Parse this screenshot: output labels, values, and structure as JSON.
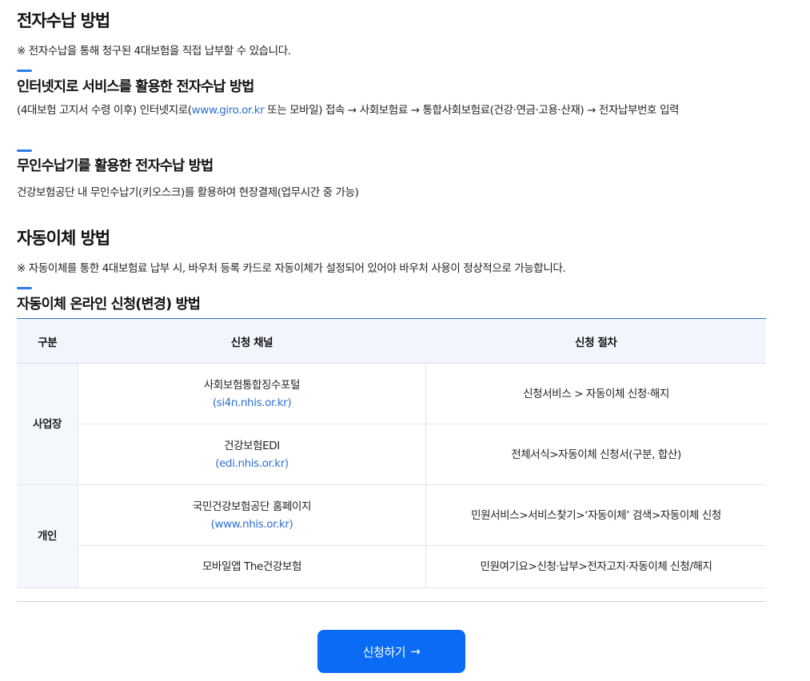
{
  "sections": {
    "e_payment": {
      "title": "전자수납 방법",
      "note": "※ 전자수납을 통해 청구된 4대보험을 직접 납부할 수 있습니다.",
      "internet": {
        "title": "인터넷지로 서비스를 활용한 전자수납 방법",
        "desc_before": "(4대보험 고지서 수령 이후) 인터넷지로(",
        "link": "www.giro.or.kr",
        "desc_after": " 또는 모바일) 접속 → 사회보험료 → 통합사회보험료(건강·연금·고용·산재) → 전자납부번호 입력"
      },
      "kiosk": {
        "title": "무인수납기를 활용한 전자수납 방법",
        "desc": "건강보험공단 내 무인수납기(키오스크)를 활용하여 현장결제(업무시간 중 가능)"
      }
    },
    "auto_transfer": {
      "title": "자동이체 방법",
      "note": "※ 자동이체를 통한 4대보험료 납부 시, 바우처 등록 카드로 자동이체가 설정되어 있어야 바우처 사용이 정상적으로 가능합니다.",
      "online": {
        "title": "자동이체 온라인 신청(변경) 방법"
      }
    }
  },
  "table": {
    "headers": [
      "구분",
      "신청 채널",
      "신청 절차"
    ],
    "groups": [
      {
        "category": "사업장",
        "rows": [
          {
            "channel": "사회보험통합징수포털",
            "link": "(si4n.nhis.or.kr)",
            "procedure": "신청서비스 > 자동이체 신청·해지"
          },
          {
            "channel": "건강보험EDI",
            "link": "(edi.nhis.or.kr)",
            "procedure": "전체서식>자동이체 신청서(구분, 합산)"
          }
        ]
      },
      {
        "category": "개인",
        "rows": [
          {
            "channel": "국민건강보험공단 홈페이지",
            "link": "(www.nhis.or.kr)",
            "procedure": "민원서비스>서비스찾기>‘자동이체’ 검색>자동이체 신청"
          },
          {
            "channel": "모바일앱 The건강보험",
            "link": "",
            "procedure": "민원여기요>신청·납부>전자고지·자동이체 신청/해지"
          }
        ]
      }
    ]
  },
  "apply_button": {
    "label": "신청하기",
    "arrow": "→"
  },
  "colors": {
    "accent": "#2b7de9",
    "link": "#2f6fd6",
    "button": "#0a6cf5",
    "table_header_bg": "#f2f6fc"
  }
}
